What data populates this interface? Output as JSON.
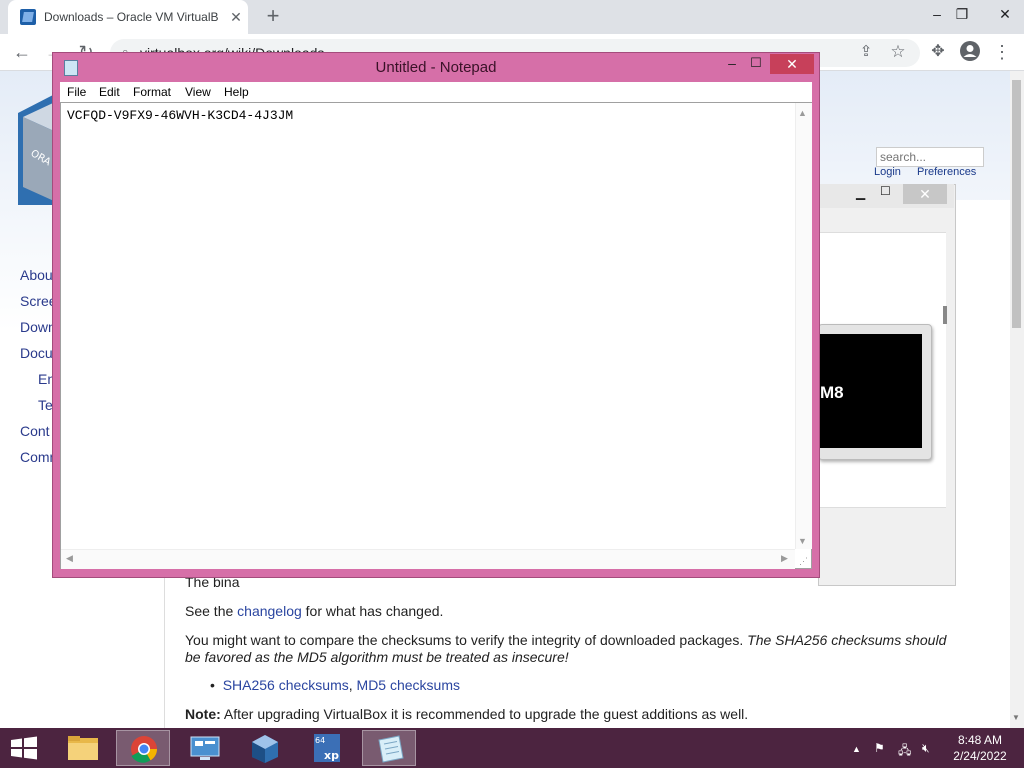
{
  "browser": {
    "tab_title": "Downloads – Oracle VM VirtualB",
    "tab_close": "✕",
    "new_tab": "+",
    "url": "virtualbox.org/wiki/Downloads",
    "window_controls": {
      "minimize": "–",
      "maximize": "❐",
      "close": "✕"
    }
  },
  "page": {
    "search_placeholder": "search...",
    "login": "Login",
    "preferences": "Preferences",
    "nav": [
      "Abou",
      "Scree",
      "Down",
      "Docu",
      "En",
      "Te",
      "Cont",
      "Comm"
    ],
    "partial_line": "The bina",
    "changelog_pre": "See the ",
    "changelog_link": "changelog",
    "changelog_post": " for what has changed.",
    "checksum_text": "You might want to compare the checksums to verify the integrity of downloaded packages.",
    "checksum_italic": "The SHA256 checksums should be favored as the MD5 algorithm must be treated as insecure!",
    "sha256_link": "SHA256 checksums",
    "md5_link": "MD5 checksums",
    "note_label": "Note:",
    "note_text": "After upgrading VirtualBox it is recommended to upgrade the guest additions as well.",
    "vm_screen_text": "M8"
  },
  "notepad": {
    "title": "Untitled - Notepad",
    "menu": [
      "File",
      "Edit",
      "Format",
      "View",
      "Help"
    ],
    "content": "VCFQD-V9FX9-46WVH-K3CD4-4J3JM",
    "controls": {
      "minimize": "–",
      "maximize": "☐",
      "close": "✕"
    }
  },
  "taskbar": {
    "time": "8:48 AM",
    "date": "2/24/2022",
    "tray_up": "▲"
  },
  "colors": {
    "notepad_frame": "#d66fa8",
    "taskbar": "#4c2440",
    "close_button": "#c7405a",
    "link": "#2a45a0"
  }
}
